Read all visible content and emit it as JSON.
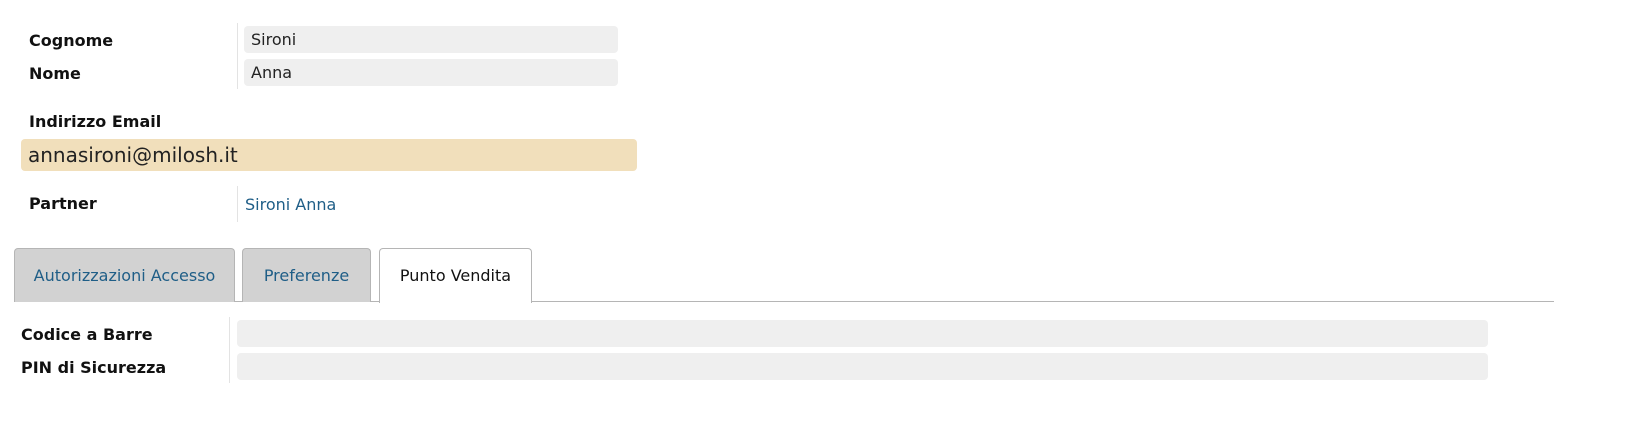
{
  "form": {
    "cognome_label": "Cognome",
    "cognome_value": "Sironi",
    "nome_label": "Nome",
    "nome_value": "Anna",
    "email_label": "Indirizzo Email",
    "email_value": "annasironi@milosh.it",
    "partner_label": "Partner",
    "partner_value": "Sironi Anna"
  },
  "tabs": [
    {
      "label": "Autorizzazioni Accesso",
      "active": false
    },
    {
      "label": "Preferenze",
      "active": false
    },
    {
      "label": "Punto Vendita",
      "active": true
    }
  ],
  "punto_vendita": {
    "barcode_label": "Codice a Barre",
    "barcode_value": "",
    "pin_label": "PIN di Sicurezza",
    "pin_value": ""
  },
  "colors": {
    "email_highlight": "#f1dfbb",
    "link": "#1f5e87",
    "field_bg": "#efefef",
    "tab_inactive_bg": "#d2d2d2"
  }
}
